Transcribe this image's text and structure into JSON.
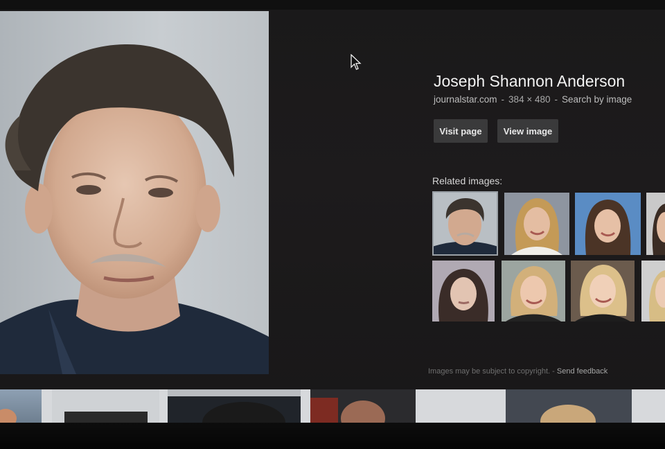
{
  "title": "Joseph Shannon Anderson",
  "meta": {
    "site": "journalstar.com",
    "separator": "-",
    "dimensions": "384 × 480",
    "search_by_image": "Search by image"
  },
  "buttons": {
    "visit_page": "Visit page",
    "view_image": "View image"
  },
  "related": {
    "label": "Related images:",
    "thumbnails": [
      {
        "subject": "man mugshot",
        "selected": true
      },
      {
        "subject": "blonde woman portrait"
      },
      {
        "subject": "brunette woman portrait"
      },
      {
        "subject": "partial portrait"
      },
      {
        "subject": "woman mugshot"
      },
      {
        "subject": "blonde woman portrait"
      },
      {
        "subject": "blonde woman portrait"
      },
      {
        "subject": "partial portrait"
      }
    ]
  },
  "footer": {
    "copyright": "Images may be subject to copyright.",
    "separator": "-",
    "feedback": "Send feedback"
  },
  "colors": {
    "panel_background": "#1b1a1b",
    "button_background": "#3a3a3b",
    "title_text": "#f2f2f2",
    "meta_text": "#a9a9a9"
  }
}
